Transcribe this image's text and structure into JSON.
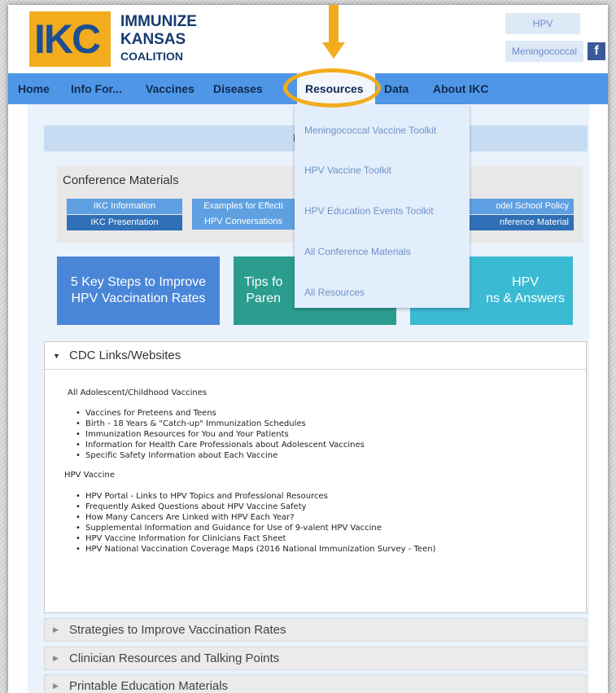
{
  "brand": {
    "logo_mark": "IKC",
    "name_line1": "IMMUNIZE",
    "name_line2": "KANSAS",
    "name_line3": "COALITION",
    "accent_color": "#f2ac1d",
    "nav_color": "#4f97e6"
  },
  "header_links": [
    "HPV",
    "Meningococcal"
  ],
  "social": {
    "facebook": "f"
  },
  "nav": {
    "items": [
      "Home",
      "Info For...",
      "Vaccines",
      "Diseases",
      "Resources",
      "Data",
      "About IKC"
    ],
    "active": "Resources"
  },
  "page_title": "R",
  "conference": {
    "title": "Conference Materials",
    "buttons": [
      "IKC Information",
      "IKC Presentation",
      "Examples for Effecti",
      "HPV Conversations",
      "odel School Policy",
      "nference Material"
    ]
  },
  "feature_tiles": [
    {
      "line1": "5 Key Steps to Improve",
      "line2": "HPV Vaccination Rates"
    },
    {
      "line1": "Tips fo",
      "line2": "Paren"
    },
    {
      "line1": "HPV",
      "line2": "ns & Answers"
    }
  ],
  "resources_menu": [
    "Meningococcal Vaccine Toolkit",
    "HPV Vaccine Toolkit",
    "HPV Education Events Toolkit",
    "All Conference Materials",
    "All Resources"
  ],
  "accordion_open": {
    "title": "CDC Links/Websites",
    "sections": [
      {
        "title": "All Adolescent/Childhood Vaccines",
        "items": [
          "Vaccines for Preteens and Teens",
          "Birth - 18 Years & \"Catch-up\" Immunization Schedules",
          "Immunization Resources for You and Your Patients",
          "Information for Health Care Professionals about Adolescent Vaccines",
          "Specific Safety Information about Each Vaccine"
        ]
      },
      {
        "title": "HPV Vaccine",
        "items": [
          "HPV Portal - Links to HPV Topics and Professional Resources",
          "Frequently Asked Questions about HPV Vaccine Safety",
          "How Many Cancers Are Linked with HPV Each Year?",
          "Supplemental Information and Guidance for Use of 9-valent HPV Vaccine",
          "HPV Vaccine Information for Clinicians Fact Sheet",
          "HPV National Vaccination Coverage Maps (2016 National Immunization Survey - Teen)"
        ]
      }
    ]
  },
  "accordion_closed": [
    "Strategies to Improve Vaccination Rates",
    "Clinician Resources and Talking Points",
    "Printable Education Materials"
  ]
}
